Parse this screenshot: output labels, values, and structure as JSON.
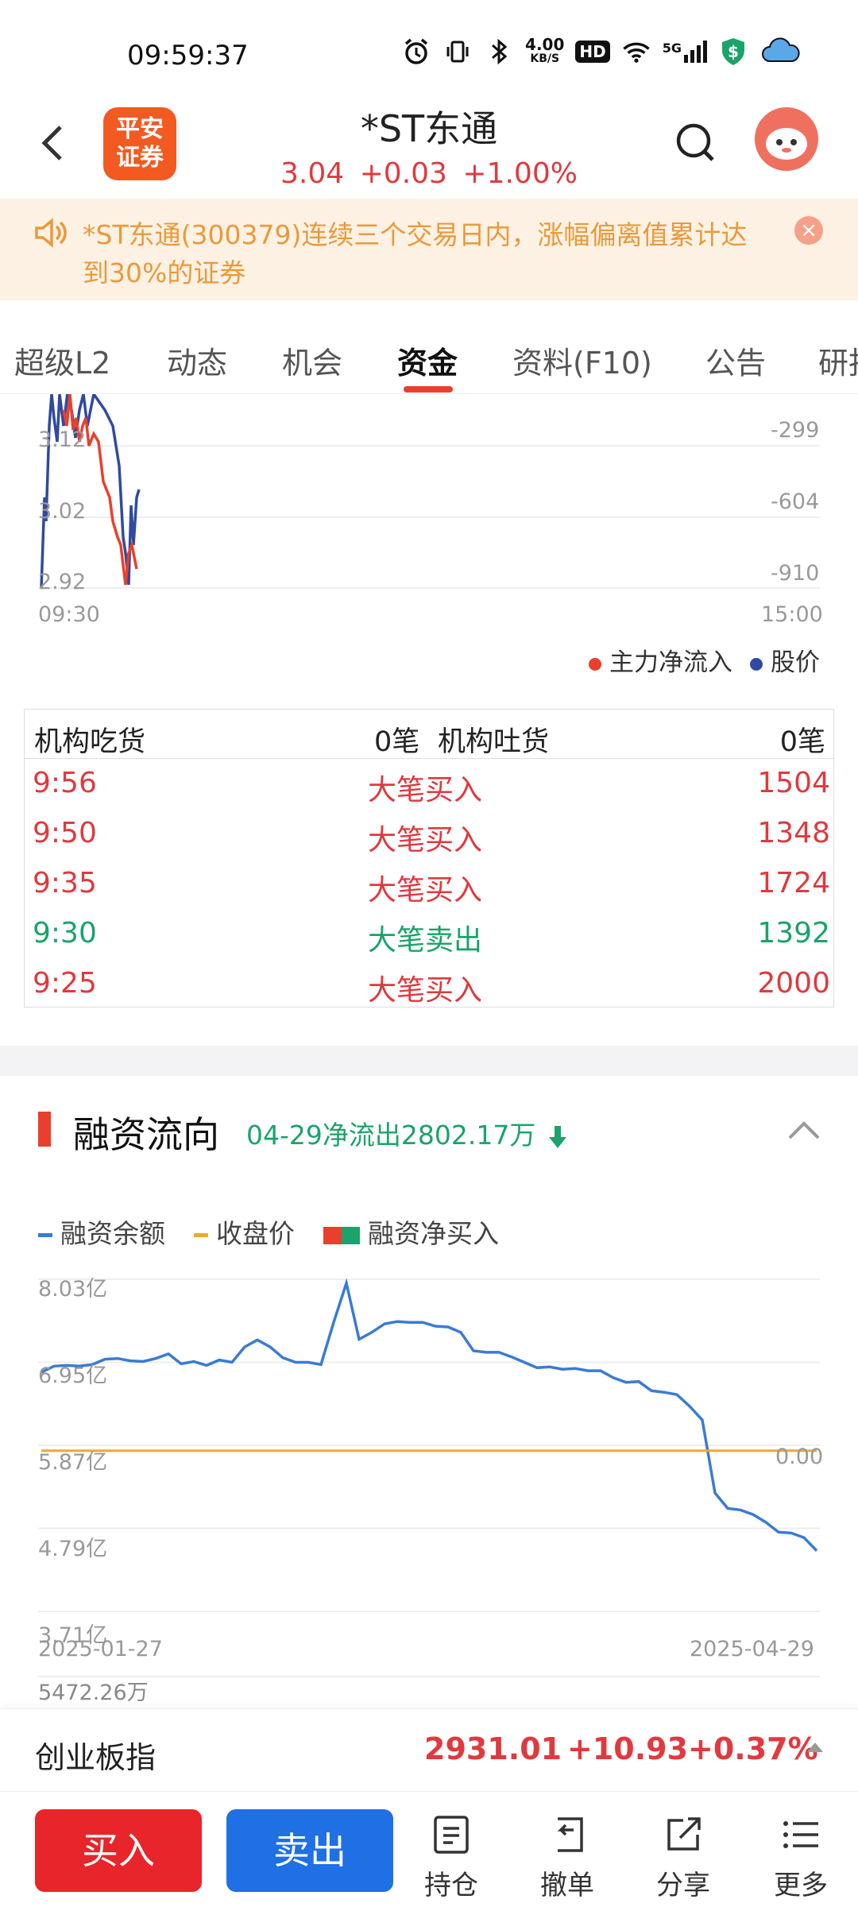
{
  "status_bar": {
    "time": "09:59:37",
    "net_speed_value": "4.00",
    "net_speed_unit": "KB/S",
    "hd": "HD",
    "signal": "5G"
  },
  "header": {
    "logo_line1": "平安",
    "logo_line2": "证券",
    "stock_name": "*ST东通",
    "price": "3.04",
    "change": "+0.03",
    "change_pct": "+1.00%"
  },
  "notice": {
    "text": "*ST东通(300379)连续三个交易日内，涨幅偏离值累计达到30%的证券"
  },
  "tabs": [
    {
      "label": "超级L2"
    },
    {
      "label": "动态"
    },
    {
      "label": "机会"
    },
    {
      "label": "资金"
    },
    {
      "label": "资料(F10)"
    },
    {
      "label": "公告"
    },
    {
      "label": "研报"
    }
  ],
  "flow_chart": {
    "y_left_labels": [
      "3.12",
      "3.02",
      "2.92"
    ],
    "y_right_labels": [
      "-299",
      "-604",
      "-910"
    ],
    "x_start": "09:30",
    "x_end": "15:00",
    "legend": [
      {
        "name": "主力净流入",
        "color": "#e8402c"
      },
      {
        "name": "股价",
        "color": "#2f4aa0"
      }
    ]
  },
  "institution_table": {
    "buy_label": "机构吃货",
    "buy_count": "0笔",
    "sell_label": "机构吐货",
    "sell_count": "0笔",
    "rows": [
      {
        "time": "9:56",
        "type": "大笔买入",
        "volume": "1504",
        "side": "buy"
      },
      {
        "time": "9:50",
        "type": "大笔买入",
        "volume": "1348",
        "side": "buy"
      },
      {
        "time": "9:35",
        "type": "大笔买入",
        "volume": "1724",
        "side": "buy"
      },
      {
        "time": "9:30",
        "type": "大笔卖出",
        "volume": "1392",
        "side": "sell"
      },
      {
        "time": "9:25",
        "type": "大笔买入",
        "volume": "2000",
        "side": "buy"
      }
    ]
  },
  "margin_section": {
    "title": "融资流向",
    "subtitle": "04-29净流出2802.17万",
    "legend": [
      {
        "name": "融资余额",
        "color": "#3a7bd5"
      },
      {
        "name": "收盘价",
        "color": "#f0a830"
      },
      {
        "name": "融资净买入",
        "color": "#e8402c"
      }
    ]
  },
  "chart_data": {
    "type": "line",
    "x_start": "2025-01-27",
    "x_end": "2025-04-29",
    "y_labels": [
      "8.03亿",
      "6.95亿",
      "5.87亿",
      "4.79亿",
      "3.71亿"
    ],
    "ylim": [
      3.71,
      8.03
    ],
    "right_label": "0.00",
    "bottom_label": "5472.26万",
    "series": [
      {
        "name": "融资余额",
        "color": "#3a7bd5",
        "values": [
          6.82,
          6.9,
          6.91,
          6.9,
          6.92,
          6.99,
          7.0,
          6.97,
          6.96,
          7.0,
          7.06,
          6.93,
          6.96,
          6.91,
          6.98,
          6.95,
          7.15,
          7.24,
          7.15,
          7.01,
          6.95,
          6.95,
          6.92,
          7.47,
          7.98,
          7.25,
          7.34,
          7.45,
          7.48,
          7.47,
          7.47,
          7.42,
          7.41,
          7.34,
          7.1,
          7.08,
          7.08,
          7.02,
          6.95,
          6.88,
          6.89,
          6.86,
          6.87,
          6.84,
          6.84,
          6.75,
          6.69,
          6.7,
          6.58,
          6.56,
          6.53,
          6.38,
          6.2,
          5.25,
          5.05,
          5.03,
          4.97,
          4.87,
          4.74,
          4.73,
          4.67,
          4.5
        ]
      },
      {
        "name": "收盘价",
        "color": "#f0a830",
        "values": [
          5.8,
          5.8
        ]
      }
    ]
  },
  "index_bar": {
    "name": "创业板指",
    "value": "2931.01",
    "change": "+10.93",
    "change_pct": "+0.37%"
  },
  "bottom_bar": {
    "buy": "买入",
    "sell": "卖出",
    "items": [
      {
        "label": "持仓"
      },
      {
        "label": "撤单"
      },
      {
        "label": "分享"
      },
      {
        "label": "更多"
      }
    ]
  }
}
